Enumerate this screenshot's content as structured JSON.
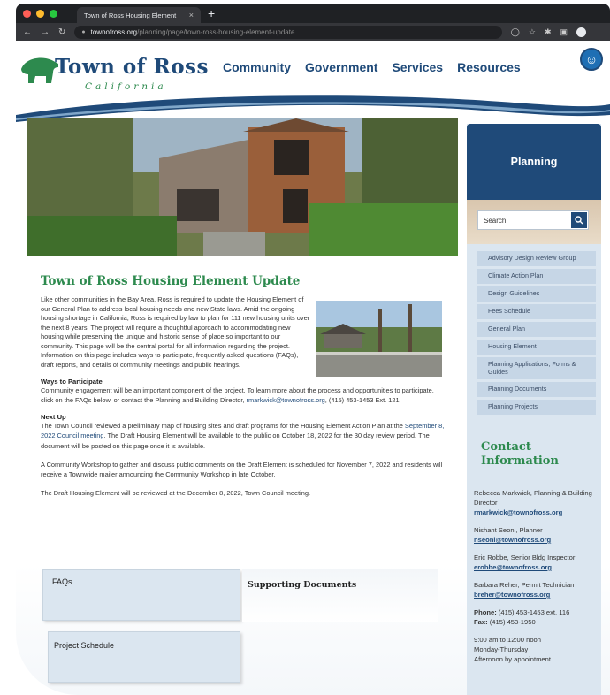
{
  "browser": {
    "tab_title": "Town of Ross Housing Element",
    "tab_close": "×",
    "new_tab": "+",
    "url_domain": "townofross.org",
    "url_path": "/planning/page/town-ross-housing-element-update"
  },
  "header": {
    "logo_title": "Town of Ross",
    "logo_subtitle": "California",
    "nav": [
      "Community",
      "Government",
      "Services",
      "Resources"
    ]
  },
  "sidebar": {
    "heading": "Planning",
    "search_placeholder": "Search",
    "menu": [
      "Advisory Design Review Group",
      "Climate Action Plan",
      "Design Guidelines",
      "Fees Schedule",
      "General Plan",
      "Housing Element",
      "Planning Applications, Forms & Guides",
      "Planning Documents",
      "Planning Projects"
    ],
    "contact_title_1": "Contact",
    "contact_title_2": "Information",
    "contacts": [
      {
        "name": "Rebecca Markwick, Planning & Building Director",
        "email": "rmarkwick@townofross.org"
      },
      {
        "name": "Nishant Seoni, Planner",
        "email": "nseoni@townofross.org"
      },
      {
        "name": "Eric Robbe, Senior Bldg Inspector",
        "email": "erobbe@townofross.org"
      },
      {
        "name": "Barbara Reher, Permit Technician",
        "email": "breher@townofross.org"
      }
    ],
    "phone_label": "Phone:",
    "phone": "(415) 453-1453 ext. 116",
    "fax_label": "Fax:",
    "fax": "(415) 453-1950",
    "hours_1": "9:00 am to 12:00 noon",
    "hours_2": "Monday-Thursday",
    "hours_3": "Afternoon by appointment"
  },
  "main": {
    "title": "Town of Ross Housing Element Update",
    "intro": "Like other communities in the Bay Area, Ross is required to update the Housing Element of our General Plan to address local housing needs and new State laws. Amid the ongoing housing shortage in California, Ross is required by law to plan for 111 new housing units over the next 8 years. The project will require a thoughtful approach to accommodating new housing while preserving the unique and historic sense of place so important to our community. This page will be the central portal for all information regarding the project. Information on this page includes ways to participate, frequently asked questions (FAQs), draft reports, and details of community meetings and public hearings.",
    "ways_heading": "Ways to Participate",
    "ways_text": "Community engagement will be an important component of the project. To learn more about the process and opportunities to participate, click on the FAQs below, or contact the Planning and Building Director,",
    "ways_email": "rmarkwick@townofross.org",
    "ways_phone": ", (415) 453-1453 Ext. 121.",
    "next_heading": "Next Up",
    "next_text_1": "The Town Council reviewed a preliminary map of housing sites and draft programs for the Housing Element Action Plan at the",
    "next_link": "September 8, 2022 Council meeting",
    "next_text_2": ". The Draft Housing Element will be available to the public on October 18, 2022 for the 30 day review period. The document will be posted on this page once it is available.",
    "workshop_text": "A Community Workshop to gather and discuss public comments on the Draft Element is scheduled for November 7, 2022 and residents will receive a Townwide mailer announcing the Community Workshop in late October.",
    "review_text": "The Draft Housing Element will be reviewed at the December 8, 2022, Town Council meeting.",
    "faq_label": "FAQs",
    "schedule_label": "Project Schedule",
    "supporting_label": "Supporting Documents"
  },
  "colors": {
    "brand_blue": "#1f4a79",
    "brand_green": "#2d8a4e",
    "sidebar_bg": "#dbe6f0"
  }
}
